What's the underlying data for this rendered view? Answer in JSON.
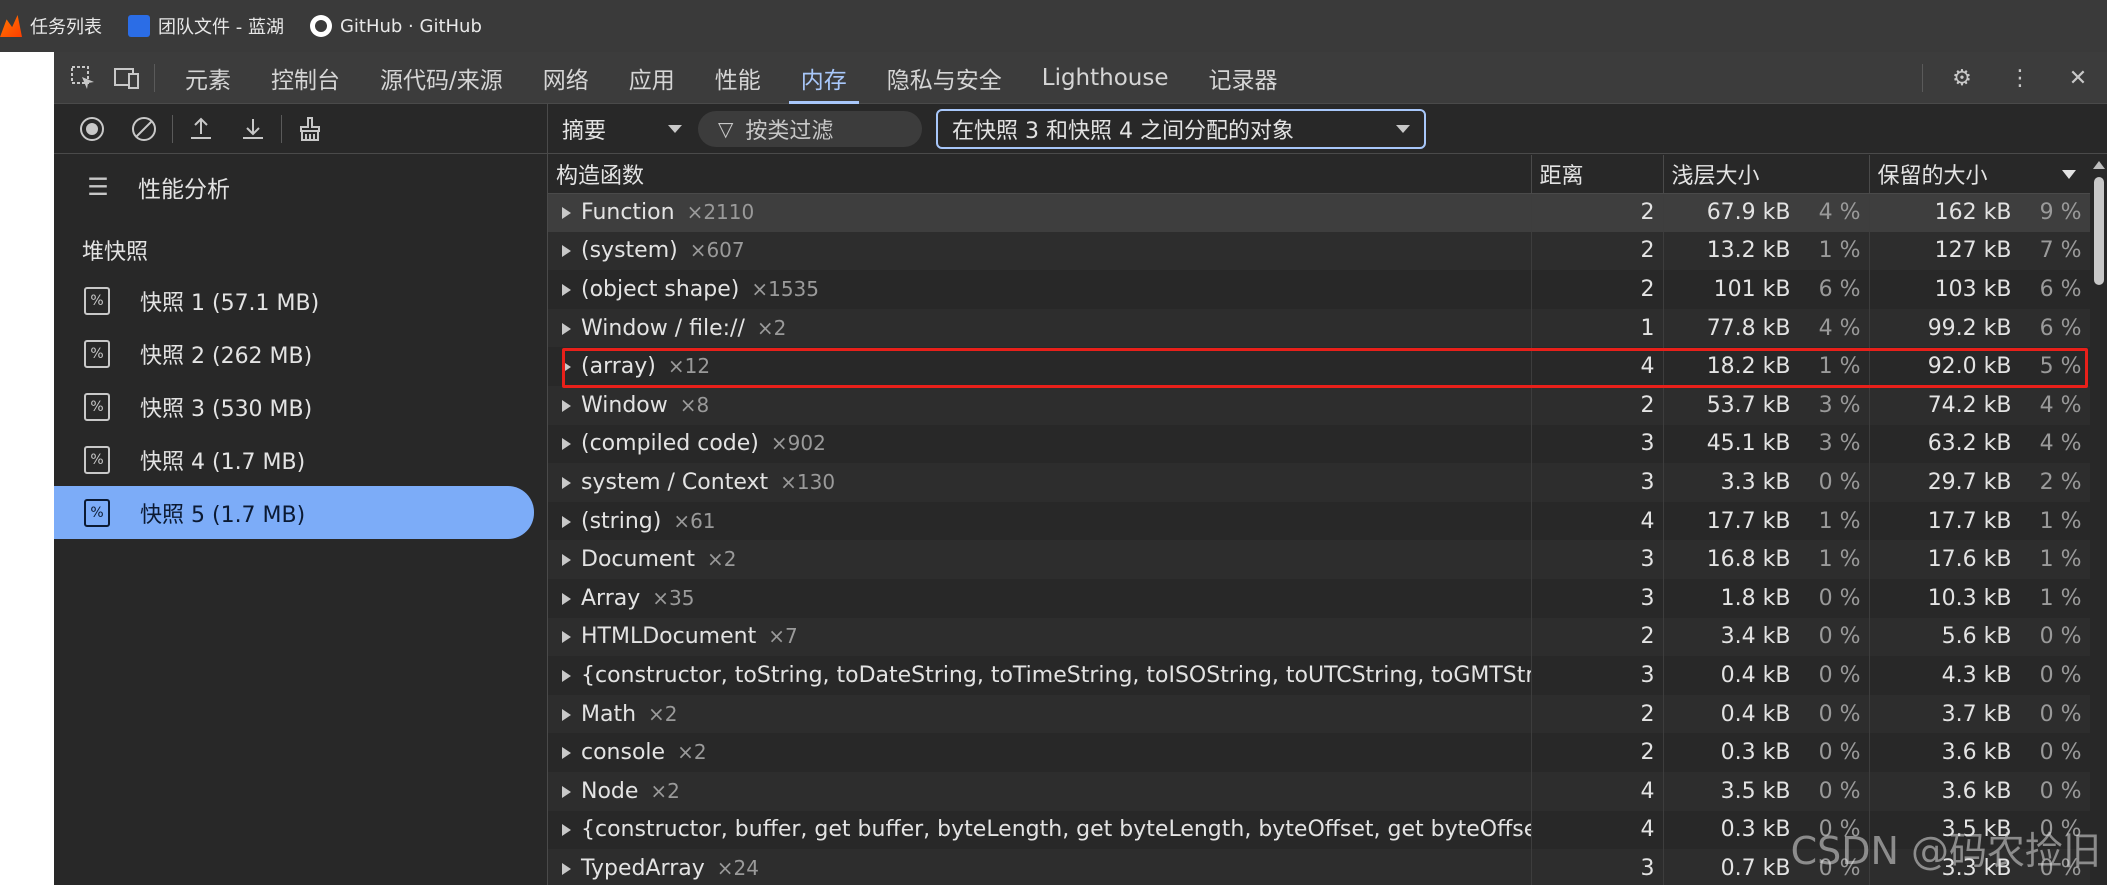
{
  "bookmarks": [
    {
      "label": "任务列表",
      "icon": "favicon-icon"
    },
    {
      "label": "团队文件 - 蓝湖",
      "icon": "lanhu-icon"
    },
    {
      "label": "GitHub · GitHub",
      "icon": "github-icon"
    }
  ],
  "devtools": {
    "tabs": [
      "元素",
      "控制台",
      "源代码/来源",
      "网络",
      "应用",
      "性能",
      "内存",
      "隐私与安全",
      "Lighthouse",
      "记录器"
    ],
    "active_tab": "内存"
  },
  "left_panel": {
    "profile_type": "性能分析",
    "section_title": "堆快照",
    "snapshots": [
      {
        "label": "快照 1 (57.1 MB)",
        "selected": false
      },
      {
        "label": "快照 2 (262 MB)",
        "selected": false
      },
      {
        "label": "快照 3 (530 MB)",
        "selected": false
      },
      {
        "label": "快照 4 (1.7 MB)",
        "selected": false
      },
      {
        "label": "快照 5 (1.7 MB)",
        "selected": true
      }
    ]
  },
  "filter_bar": {
    "view": "摘要",
    "class_filter_placeholder": "按类过滤",
    "range": "在快照 3 和快照 4 之间分配的对象"
  },
  "table": {
    "columns": [
      "构造函数",
      "距离",
      "浅层大小",
      "保留的大小"
    ],
    "rows": [
      {
        "name": "Function",
        "count": "×2110",
        "distance": "2",
        "shallow": "67.9 kB",
        "shallow_pct": "4 %",
        "retained": "162 kB",
        "retained_pct": "9 %"
      },
      {
        "name": "(system)",
        "count": "×607",
        "distance": "2",
        "shallow": "13.2 kB",
        "shallow_pct": "1 %",
        "retained": "127 kB",
        "retained_pct": "7 %"
      },
      {
        "name": "(object shape)",
        "count": "×1535",
        "distance": "2",
        "shallow": "101 kB",
        "shallow_pct": "6 %",
        "retained": "103 kB",
        "retained_pct": "6 %"
      },
      {
        "name": "Window / file://",
        "count": "×2",
        "distance": "1",
        "shallow": "77.8 kB",
        "shallow_pct": "4 %",
        "retained": "99.2 kB",
        "retained_pct": "6 %"
      },
      {
        "name": "(array)",
        "count": "×12",
        "distance": "4",
        "shallow": "18.2 kB",
        "shallow_pct": "1 %",
        "retained": "92.0 kB",
        "retained_pct": "5 %"
      },
      {
        "name": "Window",
        "count": "×8",
        "distance": "2",
        "shallow": "53.7 kB",
        "shallow_pct": "3 %",
        "retained": "74.2 kB",
        "retained_pct": "4 %"
      },
      {
        "name": "(compiled code)",
        "count": "×902",
        "distance": "3",
        "shallow": "45.1 kB",
        "shallow_pct": "3 %",
        "retained": "63.2 kB",
        "retained_pct": "4 %"
      },
      {
        "name": "system / Context",
        "count": "×130",
        "distance": "3",
        "shallow": "3.3 kB",
        "shallow_pct": "0 %",
        "retained": "29.7 kB",
        "retained_pct": "2 %"
      },
      {
        "name": "(string)",
        "count": "×61",
        "distance": "4",
        "shallow": "17.7 kB",
        "shallow_pct": "1 %",
        "retained": "17.7 kB",
        "retained_pct": "1 %"
      },
      {
        "name": "Document",
        "count": "×2",
        "distance": "3",
        "shallow": "16.8 kB",
        "shallow_pct": "1 %",
        "retained": "17.6 kB",
        "retained_pct": "1 %"
      },
      {
        "name": "Array",
        "count": "×35",
        "distance": "3",
        "shallow": "1.8 kB",
        "shallow_pct": "0 %",
        "retained": "10.3 kB",
        "retained_pct": "1 %"
      },
      {
        "name": "HTMLDocument",
        "count": "×7",
        "distance": "2",
        "shallow": "3.4 kB",
        "shallow_pct": "0 %",
        "retained": "5.6 kB",
        "retained_pct": "0 %"
      },
      {
        "name": "{constructor, toString, toDateString, toTimeString, toISOString, toUTCString, toGMTStr…",
        "count": "",
        "distance": "3",
        "shallow": "0.4 kB",
        "shallow_pct": "0 %",
        "retained": "4.3 kB",
        "retained_pct": "0 %"
      },
      {
        "name": "Math",
        "count": "×2",
        "distance": "2",
        "shallow": "0.4 kB",
        "shallow_pct": "0 %",
        "retained": "3.7 kB",
        "retained_pct": "0 %"
      },
      {
        "name": "console",
        "count": "×2",
        "distance": "2",
        "shallow": "0.3 kB",
        "shallow_pct": "0 %",
        "retained": "3.6 kB",
        "retained_pct": "0 %"
      },
      {
        "name": "Node",
        "count": "×2",
        "distance": "4",
        "shallow": "3.5 kB",
        "shallow_pct": "0 %",
        "retained": "3.6 kB",
        "retained_pct": "0 %"
      },
      {
        "name": "{constructor, buffer, get buffer, byteLength, get byteLength, byteOffset, get byteOffse…",
        "count": "",
        "distance": "4",
        "shallow": "0.3 kB",
        "shallow_pct": "0 %",
        "retained": "3.5 kB",
        "retained_pct": "0 %"
      },
      {
        "name": "TypedArray",
        "count": "×24",
        "distance": "3",
        "shallow": "0.7 kB",
        "shallow_pct": "0 %",
        "retained": "3.3 kB",
        "retained_pct": "0 %"
      }
    ],
    "highlighted_row": "(array)"
  },
  "watermark": "CSDN @码农捡旧",
  "colors": {
    "accent": "#a8c7fa",
    "selected_bg": "#7cacf8",
    "highlight": "#e8201a"
  }
}
